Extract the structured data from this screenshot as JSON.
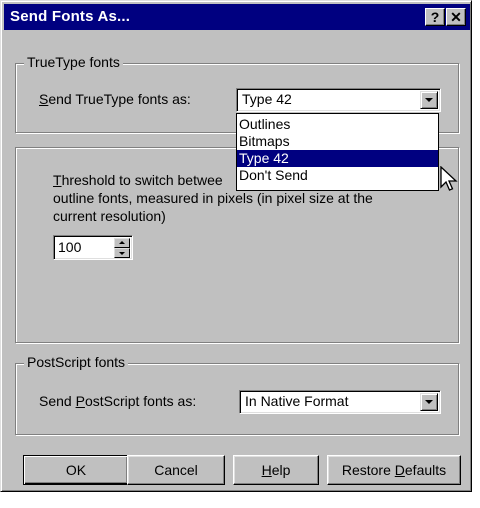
{
  "window": {
    "title": "Send Fonts As...",
    "help_glyph": "?",
    "close_glyph": "✕"
  },
  "truetype": {
    "group_label": "TrueType fonts",
    "send_label_prefix": "",
    "send_label_hotkey": "S",
    "send_label_rest": "end TrueType fonts as:",
    "selected": "Type 42",
    "options": [
      "Outlines",
      "Bitmaps",
      "Type 42",
      "Don't Send"
    ],
    "highlighted_option": "Type 42"
  },
  "threshold": {
    "label_hotkey": "T",
    "label_line1_rest": "hreshold to switch betwee",
    "label_line2": "outline fonts, measured in pixels (in pixel size at the",
    "label_line3": "current resolution)",
    "value": "100"
  },
  "postscript": {
    "group_label": "PostScript fonts",
    "send_label_prefix": "Send ",
    "send_label_hotkey": "P",
    "send_label_rest": "ostScript fonts as:",
    "selected": "In Native Format"
  },
  "buttons": {
    "ok": "OK",
    "cancel": "Cancel",
    "help_hotkey": "H",
    "help_rest": "elp",
    "restore_prefix": "Restore ",
    "restore_hotkey": "D",
    "restore_rest": "efaults"
  },
  "colors": {
    "title_bar": "#000080",
    "face": "#c0c0c0",
    "selection": "#000080"
  },
  "icons": {
    "cursor": "arrow-cursor-icon",
    "dropdown": "chevron-down-icon",
    "spin_up": "spin-up-icon",
    "spin_down": "spin-down-icon"
  }
}
